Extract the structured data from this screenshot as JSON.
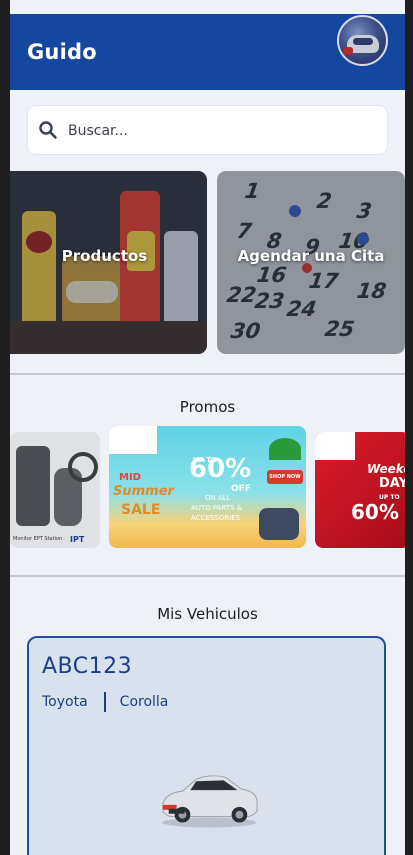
{
  "header": {
    "title": "Guido",
    "avatar": "user-avatar"
  },
  "search": {
    "placeholder": "Buscar...",
    "icon": "search-icon"
  },
  "quick_actions": [
    {
      "label": "Productos"
    },
    {
      "label": "Agendar una Cita"
    }
  ],
  "promos": {
    "title": "Promos",
    "items": [
      {
        "brand_text": "Monitor EPT Station",
        "badge": "IPT"
      },
      {
        "headline_pre": "UP TO",
        "percent": "60%",
        "percent_suffix": "OFF",
        "sub1": "ON ALL",
        "sub2": "AUTO PARTS &",
        "sub3": "ACCESSORIES",
        "side1": "MID",
        "side2": "Summer",
        "side3": "SALE",
        "cta": "SHOP NOW"
      },
      {
        "script": "Weeke",
        "script2": "DAY",
        "headline_pre": "UP TO",
        "percent": "60%"
      }
    ]
  },
  "vehicles": {
    "title": "Mis Vehiculos",
    "items": [
      {
        "plate": "ABC123",
        "make": "Toyota",
        "model": "Corolla"
      }
    ]
  },
  "colors": {
    "primary": "#1647a0",
    "background": "#eef1f7",
    "card": "#d9e1ec"
  }
}
